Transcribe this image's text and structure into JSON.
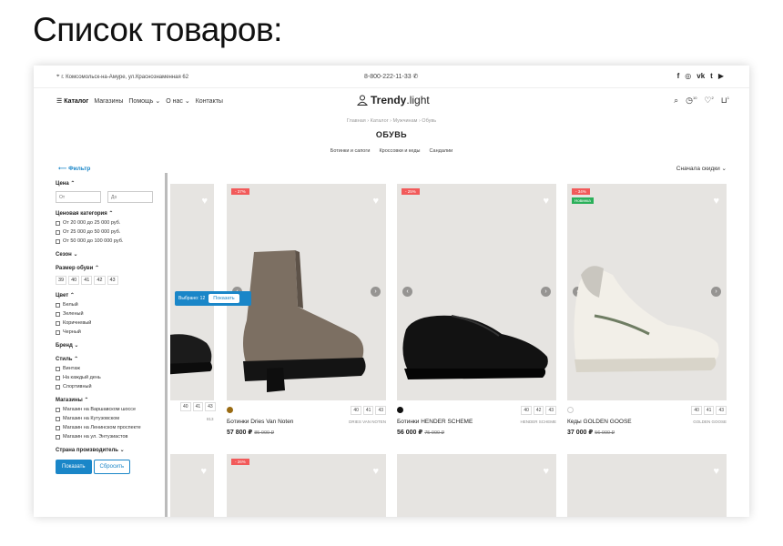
{
  "heading": "Список товаров:",
  "topbar": {
    "address": "г. Комсомольск-на-Амуре, ул.Краснознаменная 62",
    "phone": "8-800-222-11-33",
    "social": [
      "f",
      "◎",
      "vk",
      "t",
      "▶"
    ]
  },
  "nav": {
    "items": [
      "☰ Каталог",
      "Магазины",
      "Помощь ⌄",
      "О нас ⌄",
      "Контакты"
    ]
  },
  "logo": {
    "text_bold": "Trendy",
    "text_light": ".light"
  },
  "header_icons": {
    "compare_count": "10",
    "favorites_count": "2",
    "cart_count": "1"
  },
  "breadcrumbs": "Главная  ›  Каталог  ›  Мужчинам  ›  Обувь",
  "page_title": "ОБУВЬ",
  "subcategories": [
    "Ботинки и сапоги",
    "Кроссовки и кеды",
    "Сандалии"
  ],
  "filter_link": "⟵ Фильтр",
  "sort": "Сначала скидки  ⌄",
  "filters": {
    "price_title": "Цена ⌃",
    "price_from_placeholder": "От",
    "price_to_placeholder": "До",
    "price_cat_title": "Ценовая категория ⌃",
    "price_cats": [
      "От 20 000 до 25 000 руб.",
      "От 25 000 до 50 000 руб.",
      "От 50 000 до 100 000 руб."
    ],
    "season_title": "Сезон ⌄",
    "size_title": "Размер обуви ⌃",
    "sizes": [
      "39",
      "40",
      "41",
      "42",
      "43"
    ],
    "color_title": "Цвет ⌃",
    "colors": [
      "Белый",
      "Зеленый",
      "Коричневый",
      "Черный"
    ],
    "brand_title": "Бренд ⌄",
    "style_title": "Стиль ⌃",
    "styles": [
      "Винтаж",
      "На каждый день",
      "Спортивный"
    ],
    "stores_title": "Магазины ⌃",
    "stores": [
      "Магазин на Варшавском шоссе",
      "Магазин на Кутузовском",
      "Магазин на Ленинском проспекте",
      "Магазин на ул. Энтузиастов"
    ],
    "country_title": "Страна производитель ⌄",
    "show_label": "Показать",
    "reset_label": "Сбросить"
  },
  "selected_popup": {
    "text": "Выбрано: 12",
    "button": "Показать"
  },
  "partial_card": {
    "sizes": [
      "40",
      "41",
      "43"
    ],
    "brand": "813"
  },
  "products": [
    {
      "badge": "- 37%",
      "name": "Ботинки Dries Van Noten",
      "brand": "DRIES VAN NOTEN",
      "price": "57 800 ₽",
      "old_price": "85 000 ₽",
      "sizes": [
        "40",
        "41",
        "43"
      ],
      "color": "#9a6b12"
    },
    {
      "badge": "- 25%",
      "name": "Ботинки HENDER SCHEME",
      "brand": "HENDER SCHEME",
      "price": "56 000 ₽",
      "old_price": "75 000 ₽",
      "sizes": [
        "40",
        "42",
        "43"
      ],
      "color": "#111111"
    },
    {
      "badge": "- 34%",
      "badge2": "Новинка",
      "name": "Кеды GOLDEN GOOSE",
      "brand": "GOLDEN GOOSE",
      "price": "37 000 ₽",
      "old_price": "56 000 ₽",
      "sizes": [
        "40",
        "41",
        "43"
      ],
      "color": "#ffffff"
    }
  ],
  "second_row": {
    "badge": "- 26%"
  },
  "colors": {
    "accent": "#1a86c8",
    "sale": "#f25a5a",
    "new": "#2bb05a",
    "image_bg": "#e6e4e1"
  }
}
